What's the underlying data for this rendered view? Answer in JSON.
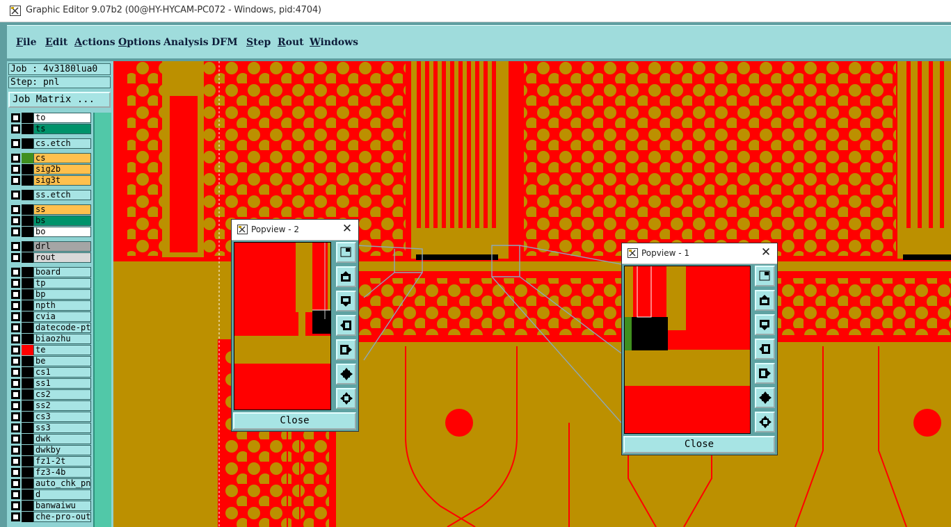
{
  "window": {
    "title": "Graphic Editor 9.07b2 (00@HY-HYCAM-PC072 - Windows, pid:4704)"
  },
  "menu": [
    "File",
    "Edit",
    "Actions",
    "Options",
    "Analysis",
    "DFM",
    "Step",
    "Rout",
    "Windows"
  ],
  "job": {
    "job_label": "Job : 4v3180lua0",
    "step_label": "Step: pnl",
    "matrix_button": "Job Matrix ..."
  },
  "layers": [
    {
      "name": "to",
      "bg": "#ffffff",
      "swatch": "#000000"
    },
    {
      "name": "ts",
      "bg": "#00936b",
      "swatch": "#000000"
    },
    {
      "name": "cs.etch",
      "bg": "#a7e4e4",
      "swatch": "#000000"
    },
    {
      "name": "cs",
      "bg": "#ffc04d",
      "swatch": "#3f8f1f"
    },
    {
      "name": "sig2b",
      "bg": "#ffc04d",
      "swatch": "#000000"
    },
    {
      "name": "sig3t",
      "bg": "#ffc04d",
      "swatch": "#000000"
    },
    {
      "name": "ss.etch",
      "bg": "#a7e4e4",
      "swatch": "#000000"
    },
    {
      "name": "ss",
      "bg": "#ffc04d",
      "swatch": "#000000"
    },
    {
      "name": "bs",
      "bg": "#00936b",
      "swatch": "#000000"
    },
    {
      "name": "bo",
      "bg": "#ffffff",
      "swatch": "#000000"
    },
    {
      "name": "drl",
      "bg": "#a5a5a5",
      "swatch": "#000000"
    },
    {
      "name": "rout",
      "bg": "#d9d9d9",
      "swatch": "#000000"
    },
    {
      "name": "board",
      "bg": "#a7e4e4",
      "swatch": "#000000"
    },
    {
      "name": "tp",
      "bg": "#a7e4e4",
      "swatch": "#000000"
    },
    {
      "name": "bp",
      "bg": "#a7e4e4",
      "swatch": "#000000"
    },
    {
      "name": "npth",
      "bg": "#a7e4e4",
      "swatch": "#000000"
    },
    {
      "name": "cvia",
      "bg": "#a7e4e4",
      "swatch": "#000000"
    },
    {
      "name": "datecode-pto",
      "bg": "#a7e4e4",
      "swatch": "#000000"
    },
    {
      "name": "biaozhu",
      "bg": "#a7e4e4",
      "swatch": "#000000"
    },
    {
      "name": "te",
      "bg": "#a7e4e4",
      "swatch": "#ff0000"
    },
    {
      "name": "be",
      "bg": "#a7e4e4",
      "swatch": "#000000"
    },
    {
      "name": "cs1",
      "bg": "#a7e4e4",
      "swatch": "#000000"
    },
    {
      "name": "ss1",
      "bg": "#a7e4e4",
      "swatch": "#000000"
    },
    {
      "name": "cs2",
      "bg": "#a7e4e4",
      "swatch": "#000000"
    },
    {
      "name": "ss2",
      "bg": "#a7e4e4",
      "swatch": "#000000"
    },
    {
      "name": "cs3",
      "bg": "#a7e4e4",
      "swatch": "#000000"
    },
    {
      "name": "ss3",
      "bg": "#a7e4e4",
      "swatch": "#000000"
    },
    {
      "name": "dwk",
      "bg": "#a7e4e4",
      "swatch": "#000000"
    },
    {
      "name": "dwkby",
      "bg": "#a7e4e4",
      "swatch": "#000000"
    },
    {
      "name": "fz1-2t",
      "bg": "#a7e4e4",
      "swatch": "#000000"
    },
    {
      "name": "fz3-4b",
      "bg": "#a7e4e4",
      "swatch": "#000000"
    },
    {
      "name": "auto_chk_pnl",
      "bg": "#a7e4e4",
      "swatch": "#000000"
    },
    {
      "name": "d",
      "bg": "#a7e4e4",
      "swatch": "#000000"
    },
    {
      "name": "banwaiwu",
      "bg": "#a7e4e4",
      "swatch": "#000000"
    },
    {
      "name": "che-pro-out",
      "bg": "#a7e4e4",
      "swatch": "#000000"
    }
  ],
  "popview2": {
    "title": "Popview - 2",
    "close_label": "Close"
  },
  "popview1": {
    "title": "Popview - 1",
    "close_label": "Close"
  },
  "colors": {
    "copper": "#bc9000",
    "board": "#ff0000",
    "ui": "#a7e4e4"
  }
}
